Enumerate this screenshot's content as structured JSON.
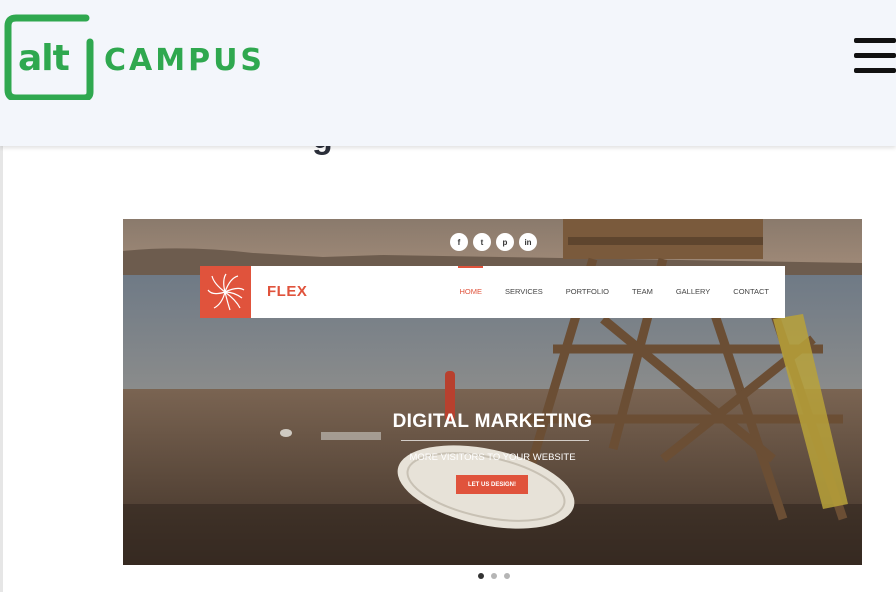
{
  "header": {
    "logo_alt": "alt",
    "logo_campus": "CAMPUS",
    "brand_color": "#2fa84f",
    "menu_icon": "hamburger-icon"
  },
  "page": {
    "partial_heading": "g"
  },
  "preview": {
    "social_icons": [
      {
        "icon": "facebook-icon",
        "glyph": "f"
      },
      {
        "icon": "twitter-icon",
        "glyph": "t"
      },
      {
        "icon": "pinterest-icon",
        "glyph": "p"
      },
      {
        "icon": "linkedin-icon",
        "glyph": "in"
      }
    ],
    "site": {
      "brand": "FLEX",
      "accent_color": "#e0533c",
      "nav": [
        "HOME",
        "SERVICES",
        "PORTFOLIO",
        "TEAM",
        "GALLERY",
        "CONTACT"
      ],
      "active_nav": "HOME"
    },
    "hero": {
      "title": "DIGITAL MARKETING",
      "subtitle": "MORE VISITORS TO YOUR WEBSITE",
      "cta": "LET US DESIGN!"
    }
  },
  "carousel": {
    "dots": 3,
    "active_dot": 1
  }
}
